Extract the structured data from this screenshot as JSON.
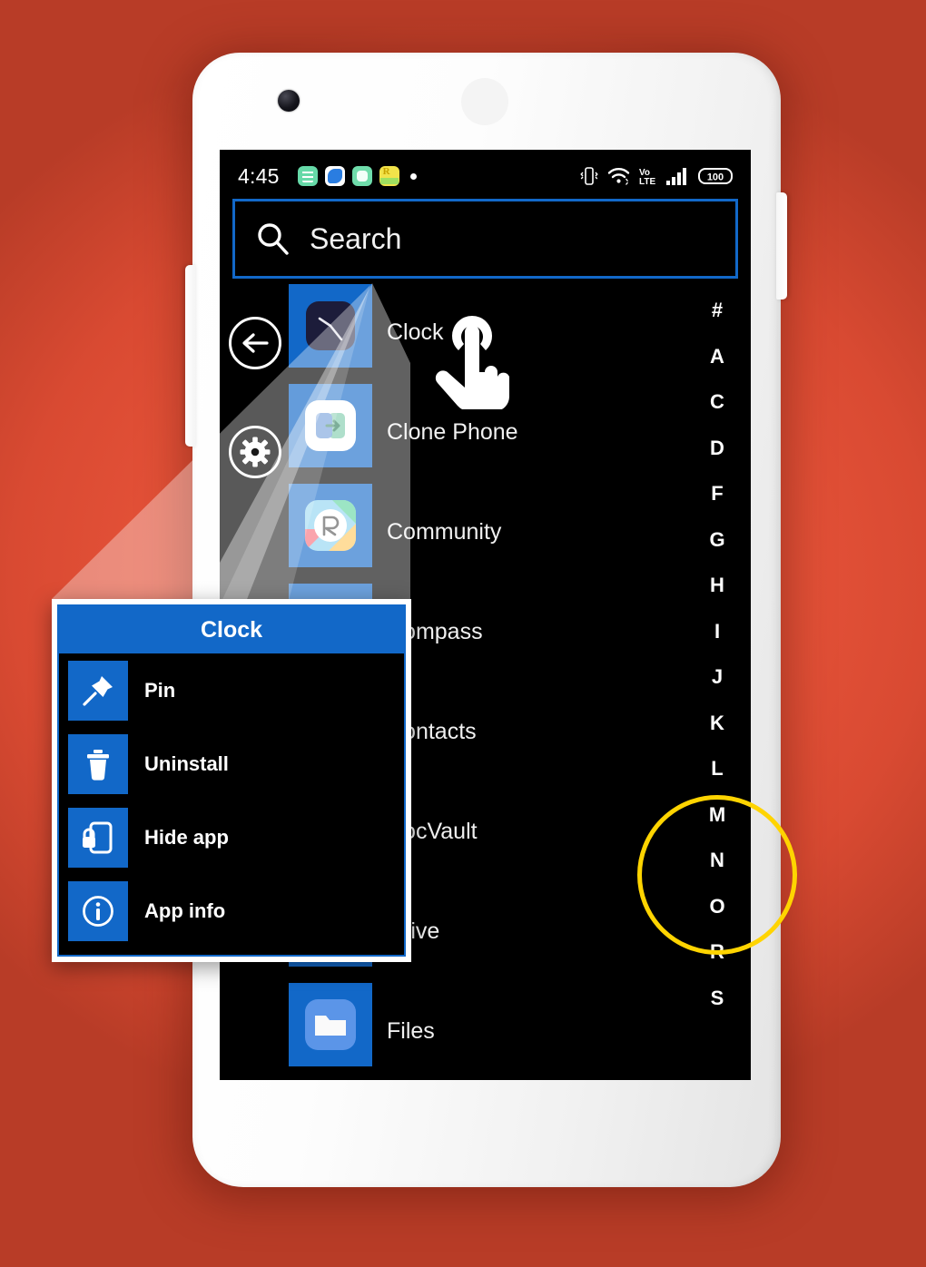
{
  "background": {
    "color": "#E8543A"
  },
  "device": {
    "frame_color": "#FFFFFF",
    "screen_bg": "#000000"
  },
  "status_bar": {
    "time": "4:45",
    "left_icons": [
      "calculator-icon",
      "browser-icon",
      "app-icon",
      "rupee-offer-icon",
      "notification-dot"
    ],
    "right_icons": [
      "vibrate-icon",
      "wifi-icon",
      "volte-icon",
      "signal-icon",
      "battery-icon"
    ],
    "battery_level": "100"
  },
  "search": {
    "placeholder": "Search",
    "icon": "search-icon",
    "border_color": "#1268C8"
  },
  "nav": {
    "back_label": "back-arrow",
    "settings_label": "gear"
  },
  "apps": [
    {
      "name": "Clock",
      "icon": "clock-icon"
    },
    {
      "name": "Clone Phone",
      "icon": "clone-phone-icon"
    },
    {
      "name": "Community",
      "icon": "realme-community-icon"
    },
    {
      "name": "Compass",
      "icon": "compass-icon"
    },
    {
      "name": "Contacts",
      "icon": "contacts-icon"
    },
    {
      "name": "DocVault",
      "icon": "docvault-icon"
    },
    {
      "name": "Drive",
      "icon": "drive-icon"
    },
    {
      "name": "Files",
      "icon": "files-icon"
    }
  ],
  "alphabet_index": [
    "#",
    "A",
    "C",
    "D",
    "F",
    "G",
    "H",
    "I",
    "J",
    "K",
    "L",
    "M",
    "N",
    "O",
    "R",
    "S"
  ],
  "highlight": {
    "ring_color": "#FFD400",
    "letters": [
      "M",
      "N",
      "O"
    ]
  },
  "context_menu": {
    "title": "Clock",
    "accent": "#1268C8",
    "items": [
      {
        "label": "Pin",
        "icon": "pin-icon"
      },
      {
        "label": "Uninstall",
        "icon": "trash-icon"
      },
      {
        "label": "Hide app",
        "icon": "hide-app-lock-icon"
      },
      {
        "label": "App info",
        "icon": "info-icon"
      }
    ]
  },
  "cursor": {
    "type": "tap-hand-icon"
  }
}
